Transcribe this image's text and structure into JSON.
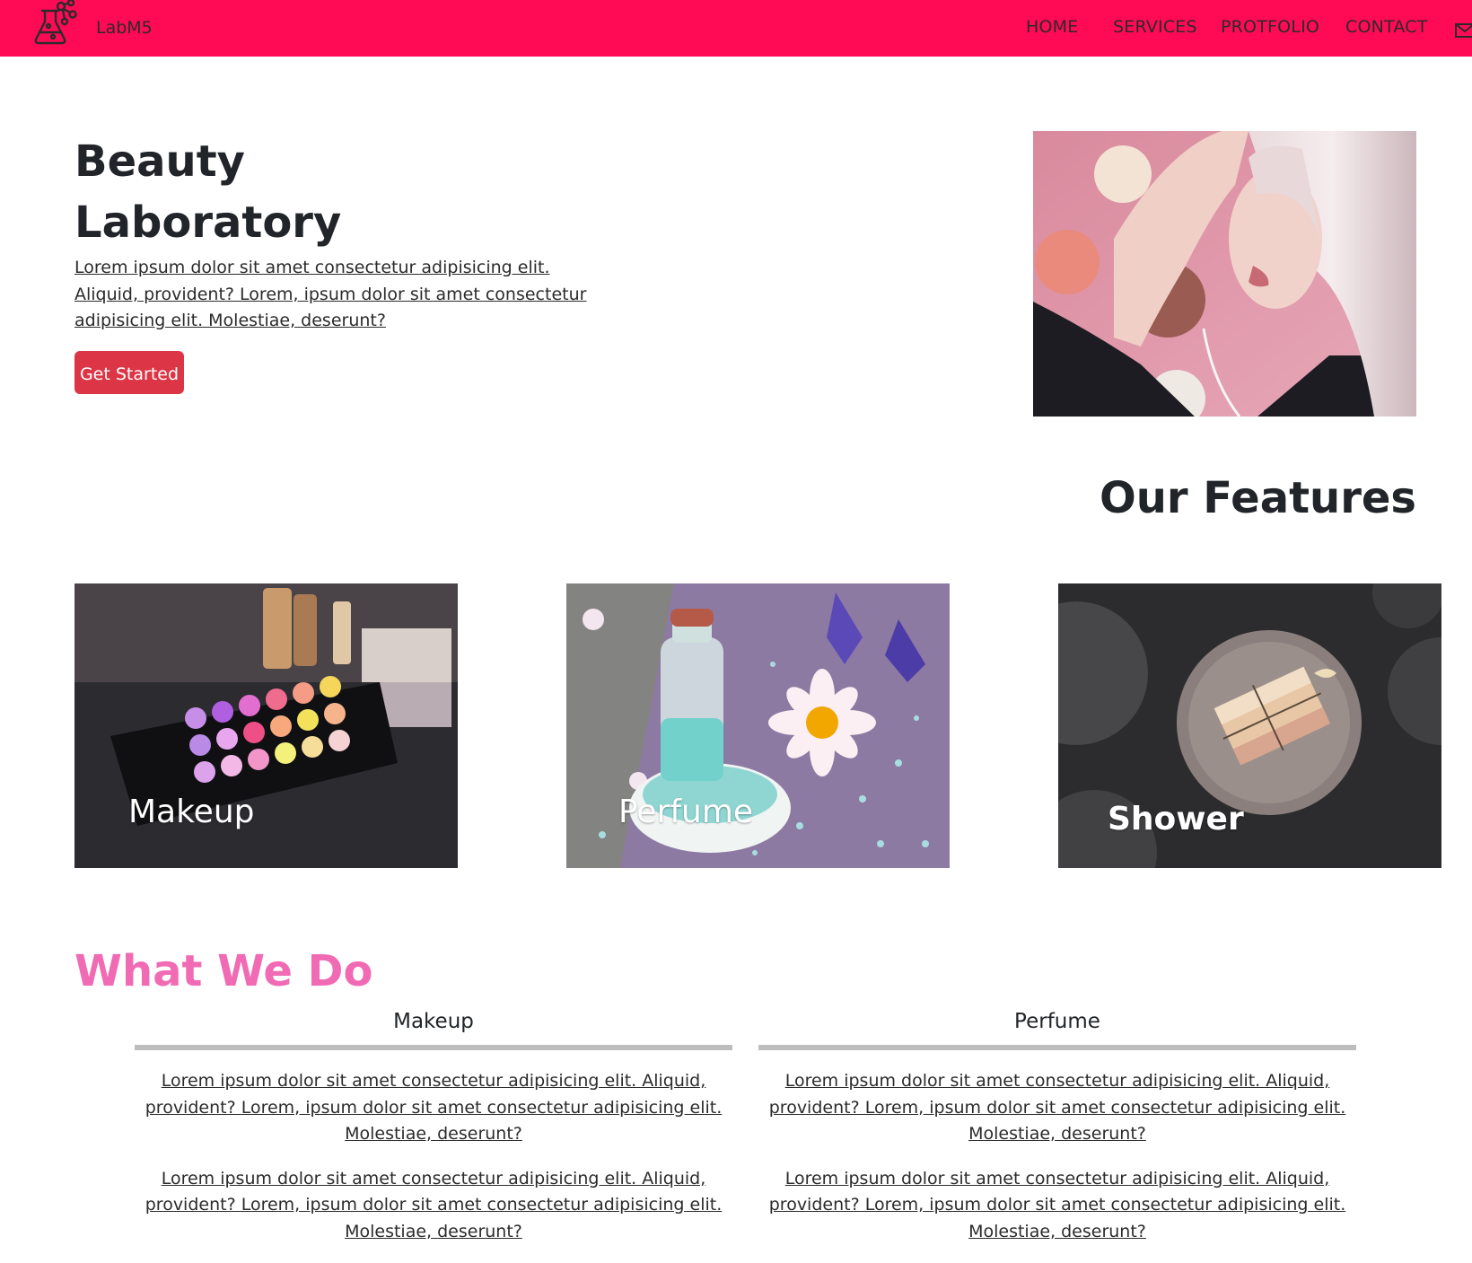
{
  "colors": {
    "navbar": "#ff0a54",
    "button": "#dc3545",
    "accent_pink": "#f06ab4"
  },
  "navbar": {
    "brand": "LabM5",
    "logo_icon": "flask-molecule-icon",
    "links": [
      "HOME",
      "SERVICES",
      "PROTFOLIO",
      "CONTACT"
    ],
    "mail_icon": "envelope-icon"
  },
  "hero": {
    "title_line1": "Beauty",
    "title_line2": "Laboratory",
    "text": "Lorem ipsum dolor sit amet consectetur adipisicing elit. Aliquid, provident? Lorem, ipsum dolor sit amet consectetur adipisicing elit. Molestiae, deserunt?",
    "button_label": "Get Started",
    "image": "portrait-photo"
  },
  "features": {
    "title": "Our Features",
    "cards": [
      {
        "label": "Makeup",
        "image": "makeup-palette-photo"
      },
      {
        "label": "Perfume",
        "image": "perfume-bottle-photo"
      },
      {
        "label": "Shower",
        "image": "soap-dish-photo"
      }
    ]
  },
  "what_we_do": {
    "title": "What We Do",
    "columns": [
      {
        "heading": "Makeup",
        "paragraphs": [
          "Lorem ipsum dolor sit amet consectetur adipisicing elit. Aliquid, provident? Lorem, ipsum dolor sit amet consectetur adipisicing elit. Molestiae, deserunt?",
          "Lorem ipsum dolor sit amet consectetur adipisicing elit. Aliquid, provident? Lorem, ipsum dolor sit amet consectetur adipisicing elit. Molestiae, deserunt?"
        ]
      },
      {
        "heading": "Perfume",
        "paragraphs": [
          "Lorem ipsum dolor sit amet consectetur adipisicing elit. Aliquid, provident? Lorem, ipsum dolor sit amet consectetur adipisicing elit. Molestiae, deserunt?",
          "Lorem ipsum dolor sit amet consectetur adipisicing elit. Aliquid, provident? Lorem, ipsum dolor sit amet consectetur adipisicing elit. Molestiae, deserunt?"
        ]
      }
    ]
  }
}
